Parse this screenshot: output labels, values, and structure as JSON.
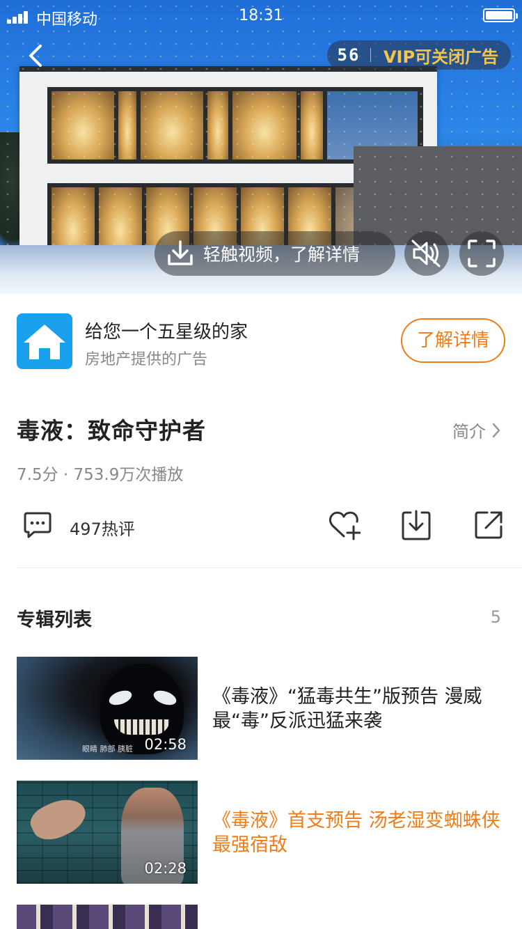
{
  "status_bar": {
    "carrier": "中国移动",
    "time": "18:31"
  },
  "ad": {
    "countdown": "56",
    "vip_close": "VIP可关闭广告",
    "detail_prompt": "轻触视频，了解详情",
    "title": "给您一个五星级的家",
    "subtitle": "房地产提供的广告",
    "cta": "了解详情",
    "logo_icon": "house-icon",
    "logo_color": "#1ba0ee",
    "accent_color": "#f07c18"
  },
  "movie": {
    "title": "毒液：致命守护者",
    "intro_label": "简介",
    "meta": "7.5分 · 753.9万次播放",
    "comments": "497热评"
  },
  "album": {
    "title": "专辑列表",
    "count": "5",
    "items": [
      {
        "duration": "02:58",
        "title": "《毒液》“猛毒共生”版预告 漫威最“毒”反派迅猛来袭",
        "thumb_caption": "眼睛  肺部  胰脏"
      },
      {
        "duration": "02:28",
        "title": "《毒液》首支预告 汤老湿变蜘蛛侠最强宿敌"
      }
    ]
  }
}
